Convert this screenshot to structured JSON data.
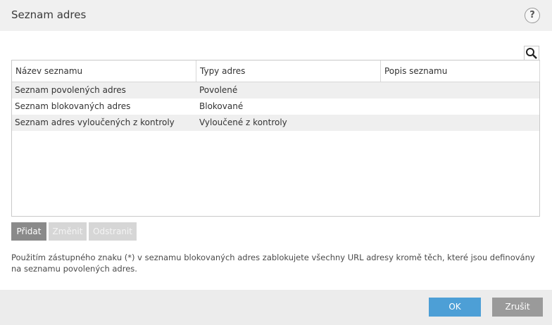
{
  "dialog": {
    "title": "Seznam adres",
    "help_label": "?"
  },
  "table": {
    "columns": [
      "Název seznamu",
      "Typy adres",
      "Popis seznamu"
    ],
    "rows": [
      {
        "name": "Seznam povolených adres",
        "type": "Povolené",
        "desc": ""
      },
      {
        "name": "Seznam blokovaných adres",
        "type": "Blokované",
        "desc": ""
      },
      {
        "name": "Seznam adres vyloučených z kontroly",
        "type": "Vyloučené z kontroly",
        "desc": ""
      }
    ]
  },
  "actions": {
    "add": "Přidat",
    "edit": "Změnit",
    "remove": "Odstranit"
  },
  "note": "Použitím zástupného znaku (*) v seznamu blokovaných adres zablokujete všechny URL adresy kromě těch, které jsou definovány na seznamu povolených adres.",
  "footer": {
    "ok": "OK",
    "cancel": "Zrušit"
  },
  "colors": {
    "ok_button": "#4d9fd6",
    "header_bg": "#f0f0f0",
    "row_alt": "#efefef",
    "disabled_button": "#d6d6d6",
    "add_button": "#8a8a8a"
  },
  "icons": {
    "search": "search-icon",
    "help": "help-icon"
  }
}
